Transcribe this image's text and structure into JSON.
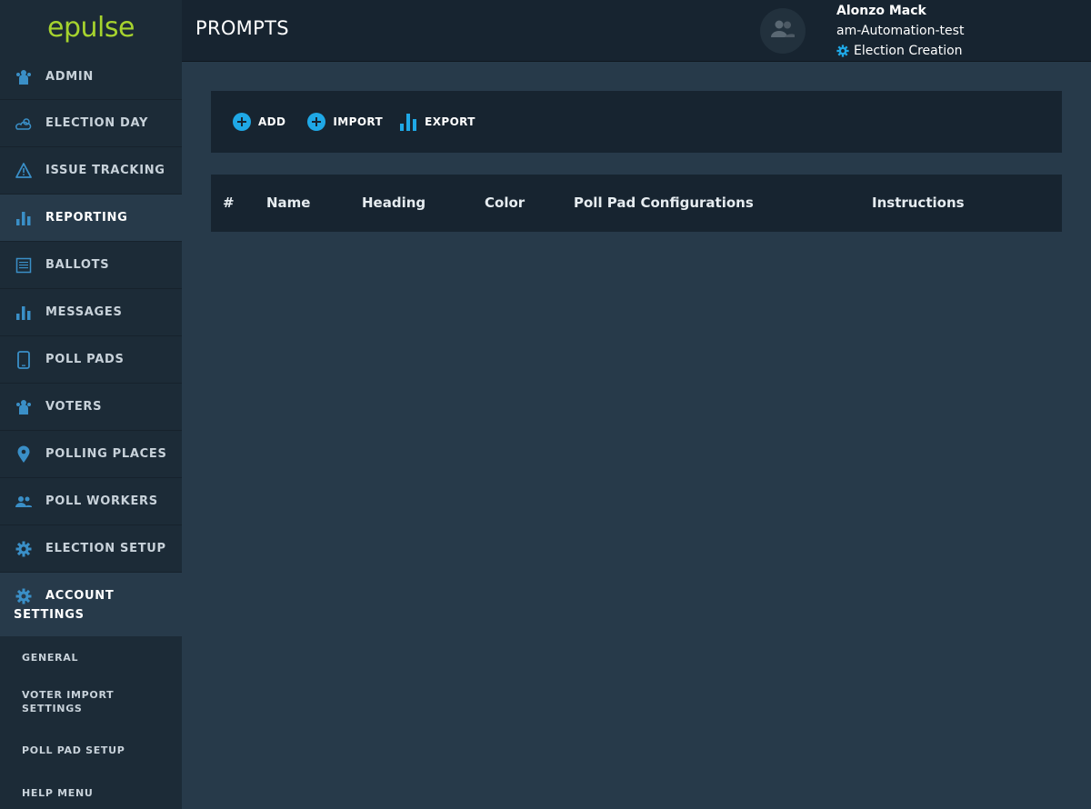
{
  "brand": {
    "logo_text": "epulse",
    "logo_color": "#a6d32e"
  },
  "sidebar": {
    "items": [
      {
        "label": "ADMIN",
        "icon": "people-icon"
      },
      {
        "label": "ELECTION DAY",
        "icon": "cloud-sun-icon"
      },
      {
        "label": "ISSUE TRACKING",
        "icon": "warning-icon"
      },
      {
        "label": "REPORTING",
        "icon": "bar-chart-icon",
        "active": true
      },
      {
        "label": "BALLOTS",
        "icon": "ballot-icon"
      },
      {
        "label": "MESSAGES",
        "icon": "bar-chart-icon"
      },
      {
        "label": "POLL PADS",
        "icon": "tablet-icon"
      },
      {
        "label": "VOTERS",
        "icon": "people-icon"
      },
      {
        "label": "POLLING PLACES",
        "icon": "map-pin-icon"
      },
      {
        "label": "POLL WORKERS",
        "icon": "group-icon"
      },
      {
        "label": "ELECTION SETUP",
        "icon": "gear-icon"
      }
    ],
    "account_settings": {
      "label_line1": "ACCOUNT",
      "label_line2": "SETTINGS",
      "icon": "gear-icon",
      "subitems": [
        "GENERAL",
        "VOTER IMPORT SETTINGS",
        "POLL PAD SETUP",
        "HELP MENU"
      ]
    }
  },
  "header": {
    "title": "PROMPTS",
    "user": {
      "name": "Alonzo Mack",
      "account": "am-Automation-test",
      "election": "Election Creation"
    }
  },
  "toolbar": {
    "add_label": "ADD",
    "import_label": "IMPORT",
    "export_label": "EXPORT"
  },
  "table": {
    "columns": [
      "#",
      "Name",
      "Heading",
      "Color",
      "Poll Pad Configurations",
      "Instructions"
    ],
    "rows": []
  },
  "colors": {
    "accent_blue": "#1fa8e6",
    "icon_blue": "#3a8fc7",
    "sidebar_bg": "#1c2b37",
    "main_bg": "#273a4a",
    "panel_bg": "#172430"
  }
}
